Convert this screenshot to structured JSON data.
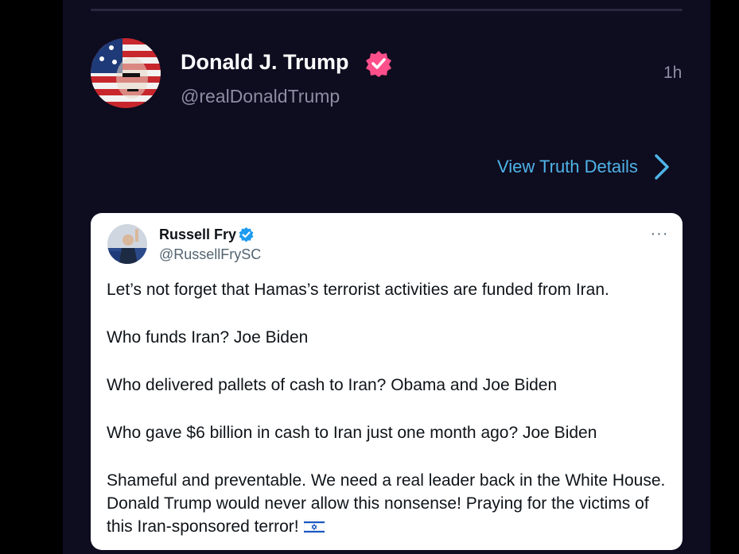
{
  "post": {
    "author_name": "Donald J. Trump",
    "author_handle": "@realDonaldTrump",
    "time": "1h",
    "view_details_label": "View Truth Details"
  },
  "quoted_tweet": {
    "author_name": "Russell Fry",
    "author_handle": "@RussellFrySC",
    "more_label": "···",
    "paragraphs": [
      "Let’s not forget that Hamas’s terrorist activities are funded from Iran.",
      "Who funds Iran? Joe Biden",
      "Who delivered pallets of cash to Iran? Obama and Joe Biden",
      "Who gave $6 billion in cash to Iran just one month ago? Joe Biden",
      "Shameful and preventable. We need a real leader back in the White House. Donald Trump would never allow this nonsense! Praying for the victims of this Iran-sponsored terror!"
    ],
    "trailing_emoji": "israel-flag-emoji"
  },
  "icons": {
    "verified_badge": "verified-badge-icon",
    "card_verified_badge": "verified-check-icon",
    "chevron": "chevron-right-icon"
  },
  "colors": {
    "background": "#0e0c1f",
    "accent": "#4fb4e8",
    "verified_badge": "#ff4f8b",
    "card_verified": "#1d9bf0",
    "text_primary": "#ffffff",
    "text_secondary": "#8f8ca3"
  }
}
